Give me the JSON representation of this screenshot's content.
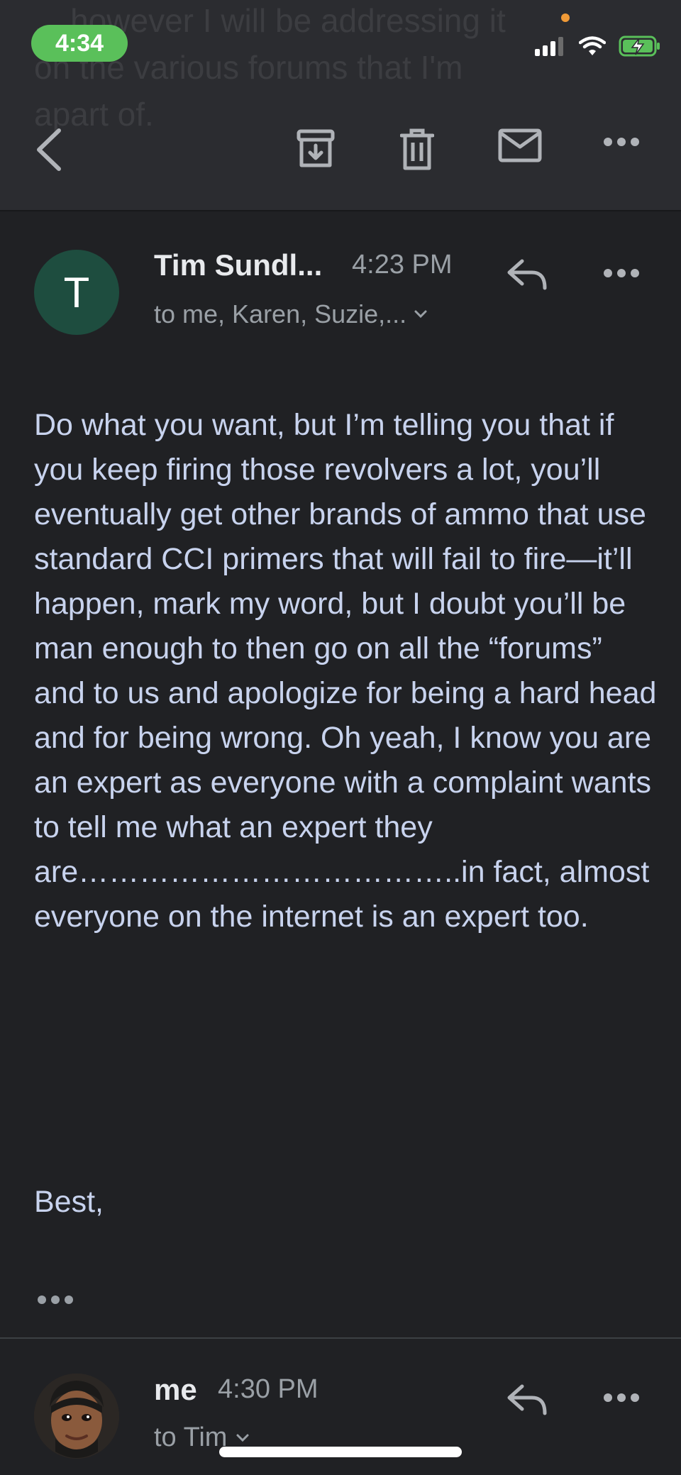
{
  "status_bar": {
    "time": "4:34"
  },
  "background_preview": {
    "text": "... however I will be addressing it\non the various forums that I'm\napart of."
  },
  "toolbar": {
    "icons": [
      "back-arrow-icon",
      "archive-icon",
      "trash-icon",
      "mail-icon",
      "more-icon"
    ]
  },
  "message1": {
    "avatar_letter": "T",
    "sender": "Tim Sundl...",
    "time": "4:23 PM",
    "recipients": "to me, Karen, Suzie,...",
    "body": "Do what you want, but I’m telling you that if you keep firing those revolvers a lot, you’ll eventually get other brands of ammo that use standard CCI primers that will fail to fire—it’ll happen, mark my word, but I doubt you’ll be man enough to then go on all the “forums” and to us and apologize for being a hard head and for being wrong. Oh yeah, I know you are an expert as everyone with a complaint wants to tell me what an expert they are………………………………..in fact, almost everyone on the internet is an expert too.",
    "signoff": "Best,"
  },
  "message2": {
    "sender": "me",
    "time": "4:30 PM",
    "recipients": "to Tim"
  },
  "colors": {
    "background": "#202124",
    "toolbar": "#2b2c30",
    "status_pill": "#5ac05a",
    "avatar_t": "#1e4d3f",
    "body_text": "#c8d3ee",
    "meta_text": "#9aa0a6"
  }
}
